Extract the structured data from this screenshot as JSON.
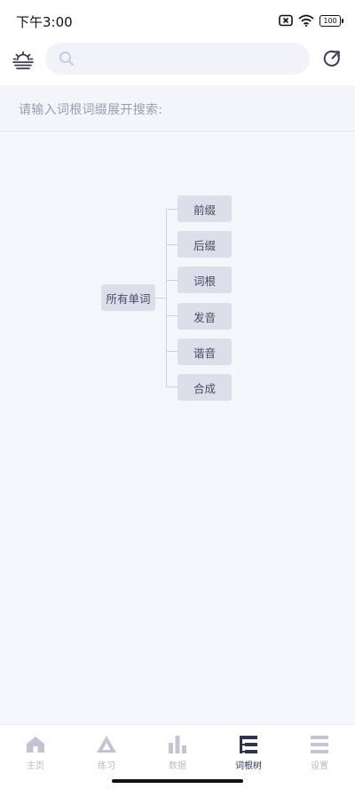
{
  "status": {
    "time": "下午3:00",
    "battery": "100"
  },
  "appbar": {
    "theme_icon": "sunrise-icon",
    "search_icon": "search-icon",
    "search_placeholder": "",
    "refresh_icon": "refresh-icon"
  },
  "hint": {
    "text": "请输入词根词缀展开搜索:"
  },
  "tree": {
    "root": "所有单词",
    "children": [
      {
        "label": "前缀"
      },
      {
        "label": "后缀"
      },
      {
        "label": "词根"
      },
      {
        "label": "发音"
      },
      {
        "label": "谐音"
      },
      {
        "label": "合成"
      }
    ]
  },
  "nav": {
    "items": [
      {
        "label": "主页",
        "icon": "home-icon"
      },
      {
        "label": "练习",
        "icon": "practice-triangle-icon"
      },
      {
        "label": "数据",
        "icon": "bar-chart-icon"
      },
      {
        "label": "词根树",
        "icon": "tree-icon",
        "active": true
      },
      {
        "label": "设置",
        "icon": "menu-lines-icon"
      }
    ]
  },
  "colors": {
    "background": "#f5f5fc",
    "node_bg": "#dcdeea",
    "nav_active": "#2f3352",
    "nav_inactive": "#b7b9c8"
  }
}
